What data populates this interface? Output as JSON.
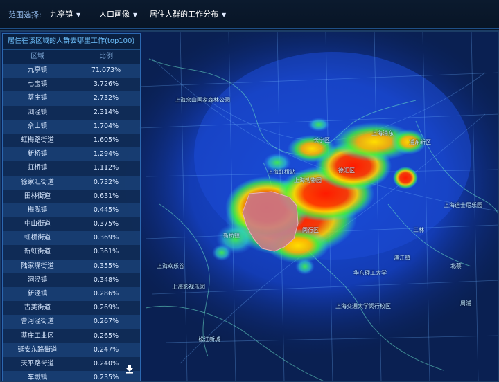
{
  "toolbar": {
    "range_label": "范围选择:",
    "town_select": "九亭镇",
    "population_select": "人口画像",
    "analysis_select": "居住人群的工作分布"
  },
  "panel": {
    "title": "居住在该区域的人群去哪里工作(top100)",
    "col_region": "区域",
    "col_ratio": "比例",
    "rows": [
      {
        "region": "九亭镇",
        "ratio": "71.073%"
      },
      {
        "region": "七宝镇",
        "ratio": "3.726%"
      },
      {
        "region": "莘庄镇",
        "ratio": "2.732%"
      },
      {
        "region": "泗泾镇",
        "ratio": "2.314%"
      },
      {
        "region": "佘山镇",
        "ratio": "1.704%"
      },
      {
        "region": "虹梅路街道",
        "ratio": "1.605%"
      },
      {
        "region": "新桥镇",
        "ratio": "1.294%"
      },
      {
        "region": "虹桥镇",
        "ratio": "1.112%"
      },
      {
        "region": "徐家汇街道",
        "ratio": "0.732%"
      },
      {
        "region": "田林街道",
        "ratio": "0.631%"
      },
      {
        "region": "梅陇镇",
        "ratio": "0.445%"
      },
      {
        "region": "中山街道",
        "ratio": "0.375%"
      },
      {
        "region": "虹桥街道",
        "ratio": "0.369%"
      },
      {
        "region": "新虹街道",
        "ratio": "0.361%"
      },
      {
        "region": "陆家嘴街道",
        "ratio": "0.355%"
      },
      {
        "region": "洞泾镇",
        "ratio": "0.348%"
      },
      {
        "region": "新泾镇",
        "ratio": "0.286%"
      },
      {
        "region": "古美街道",
        "ratio": "0.269%"
      },
      {
        "region": "曹河泾街道",
        "ratio": "0.267%"
      },
      {
        "region": "莘庄工业区",
        "ratio": "0.265%"
      },
      {
        "region": "延安东路街道",
        "ratio": "0.247%"
      },
      {
        "region": "天平路街道",
        "ratio": "0.240%"
      },
      {
        "region": "车墩镇",
        "ratio": "0.235%"
      }
    ]
  },
  "map_labels": [
    {
      "text": "长宁区",
      "id": "label-changning"
    },
    {
      "text": "徐汇区",
      "id": "label-xuhui"
    },
    {
      "text": "闵行区",
      "id": "label-minhang"
    },
    {
      "text": "浦东新区",
      "id": "label-pudong"
    },
    {
      "text": "上海浦东",
      "id": "label-shanghai-pudong"
    },
    {
      "text": "上海佘山国家森林公园",
      "id": "label-sheshan"
    },
    {
      "text": "上海欢乐谷",
      "id": "label-happy-valley"
    },
    {
      "text": "上海交通大学闵行校区",
      "id": "label-sjtu"
    },
    {
      "text": "华东理工大学",
      "id": "label-ecust"
    },
    {
      "text": "上海虹桥站",
      "id": "label-hongqiao"
    },
    {
      "text": "上海影视乐园",
      "id": "label-film-park"
    },
    {
      "text": "松江新城",
      "id": "label-songjiang"
    },
    {
      "text": "上海动物园",
      "id": "label-zoo"
    },
    {
      "text": "新桥镇",
      "id": "label-xinqiao"
    },
    {
      "text": "浦江镇",
      "id": "label-pujiang"
    },
    {
      "text": "上海迪士尼乐园",
      "id": "label-disney"
    },
    {
      "text": "周浦",
      "id": "label-zhoupu"
    },
    {
      "text": "三林",
      "id": "label-sanlin"
    },
    {
      "text": "北蔡",
      "id": "label-beicai"
    }
  ],
  "colors": {
    "accent": "#2c68b0",
    "heat_high": "#ff2a00",
    "heat_mid": "#ffe100",
    "heat_low": "#3df03d",
    "selection": "#c97b86"
  }
}
